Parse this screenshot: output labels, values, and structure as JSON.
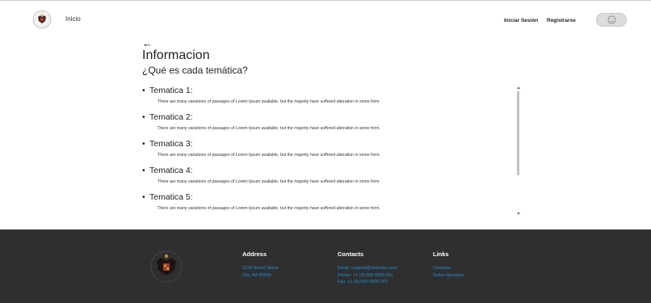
{
  "header": {
    "home_label": "Inicio",
    "login_label": "Iniciar Sesión",
    "register_label": "Registrarse"
  },
  "main": {
    "back_icon": "←",
    "title": "Informacion",
    "subtitle": "¿Qué es cada temática?",
    "items": [
      {
        "title": "Tematica 1:",
        "desc": "There are many variations of passages of Lorem Ipsum available, but the majority have suffered alteration in some form."
      },
      {
        "title": "Tematica 2:",
        "desc": "There are many variations of passages of Lorem Ipsum available, but the majority have suffered alteration in some form."
      },
      {
        "title": "Tematica 3:",
        "desc": "There are many variations of passages of Lorem Ipsum available, but the majority have suffered alteration in some form."
      },
      {
        "title": "Tematica 4:",
        "desc": "There are many variations of passages of Lorem Ipsum available, but the majority have suffered alteration in some form."
      },
      {
        "title": "Tematica 5:",
        "desc": "There are many variations of passages of Lorem Ipsum available, but the majority have suffered alteration in some form."
      }
    ]
  },
  "footer": {
    "address": {
      "heading": "Address",
      "line1": "1234 Street Name",
      "line2": "City, AA 99999"
    },
    "contacts": {
      "heading": "Contacts",
      "email": "Email: support@mobirise.com",
      "phone": "Phone: +1 (0) 000 0000 001",
      "fax": "Fax: +1 (0) 000 0000 002"
    },
    "links": {
      "heading": "Links",
      "contacto": "Contacto",
      "sobre": "Sobre Nosotros"
    }
  },
  "colors": {
    "footer_bg": "#2f2f2f",
    "link_blue": "#1f8fd6",
    "pill_bg": "#dcdcdc"
  },
  "icons": {
    "logo": "university-crest-icon",
    "user": "user-face-icon",
    "back": "arrow-left-icon"
  }
}
